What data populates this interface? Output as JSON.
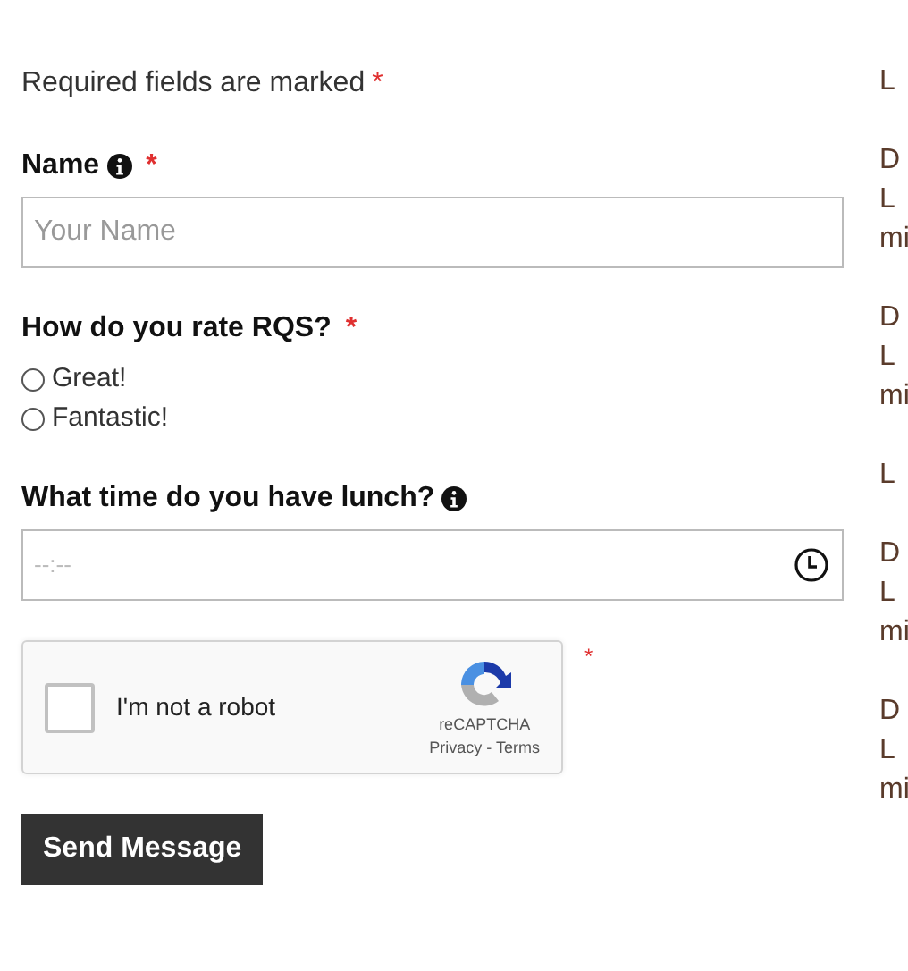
{
  "required_note": {
    "text": "Required fields are marked",
    "required_mark": "*"
  },
  "fields": [
    {
      "kind": "text",
      "label": "Name",
      "info": true,
      "required_mark": "*",
      "placeholder": "Your Name"
    },
    {
      "kind": "radio",
      "label": "How do you rate RQS?",
      "info": false,
      "required_mark": "*",
      "options": [
        {
          "label": "Great!",
          "selected": false
        },
        {
          "label": "Fantastic!",
          "selected": false
        }
      ]
    },
    {
      "kind": "time",
      "label": "What time do you have lunch?",
      "info": true,
      "placeholder": "--:--"
    }
  ],
  "captcha": {
    "label": "I'm not a robot",
    "checked": false,
    "brand": "reCAPTCHA",
    "links": "Privacy - Terms",
    "required_mark": "*"
  },
  "submit": "Send Message",
  "side_text": [
    [
      "L"
    ],
    [
      "D",
      "L",
      "mi"
    ],
    [
      "D",
      "L",
      "mi"
    ],
    [
      "L"
    ],
    [
      "D",
      "L",
      "mi"
    ],
    [
      "D",
      "L",
      "mi"
    ]
  ]
}
